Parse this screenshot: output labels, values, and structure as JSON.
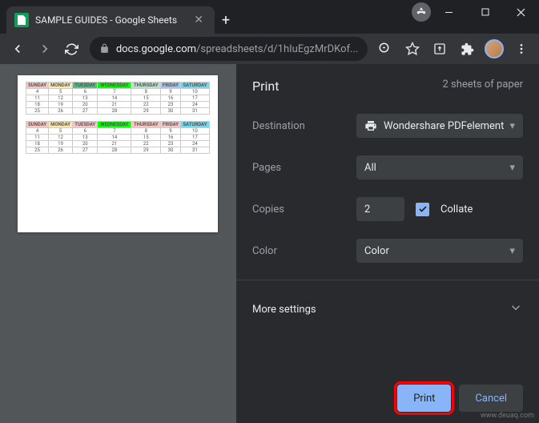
{
  "tab": {
    "title": "SAMPLE GUIDES - Google Sheets"
  },
  "url": {
    "host": "docs.google.com",
    "path": "/spreadsheets/d/1hIuEgzMrDKof..."
  },
  "dialog": {
    "title": "Print",
    "summary": "2 sheets of paper",
    "destination": {
      "label": "Destination",
      "value": "Wondershare PDFelement"
    },
    "pages": {
      "label": "Pages",
      "value": "All"
    },
    "copies": {
      "label": "Copies",
      "value": "2",
      "collate_label": "Collate",
      "collate_checked": true
    },
    "color": {
      "label": "Color",
      "value": "Color"
    },
    "more": "More settings",
    "print": "Print",
    "cancel": "Cancel"
  },
  "watermark": "www.deuaq.com"
}
